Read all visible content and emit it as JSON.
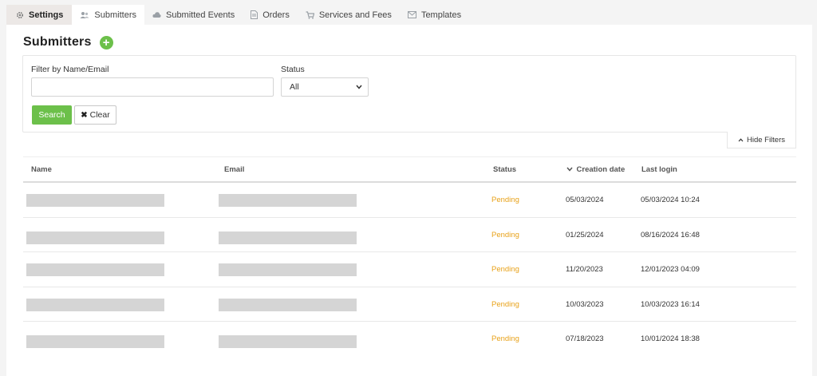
{
  "tabs": [
    {
      "label": "Settings",
      "icon": "gear-icon"
    },
    {
      "label": "Submitters",
      "icon": "users-icon"
    },
    {
      "label": "Submitted Events",
      "icon": "cloud-icon"
    },
    {
      "label": "Orders",
      "icon": "document-icon"
    },
    {
      "label": "Services and Fees",
      "icon": "cart-icon"
    },
    {
      "label": "Templates",
      "icon": "envelope-icon"
    }
  ],
  "page": {
    "title": "Submitters",
    "add_icon": "plus-circle-icon"
  },
  "filters": {
    "name_label": "Filter by Name/Email",
    "name_value": "",
    "status_label": "Status",
    "status_value": "All",
    "search_label": "Search",
    "clear_label": "Clear",
    "hide_filters_label": "Hide Filters"
  },
  "table": {
    "columns": {
      "name": "Name",
      "email": "Email",
      "status": "Status",
      "created": "Creation date",
      "last_login": "Last login"
    },
    "rows": [
      {
        "status": "Pending",
        "created": "05/03/2024",
        "last_login": "05/03/2024 10:24"
      },
      {
        "status": "Pending",
        "created": "01/25/2024",
        "last_login": "08/16/2024 16:48"
      },
      {
        "status": "Pending",
        "created": "11/20/2023",
        "last_login": "12/01/2023 04:09"
      },
      {
        "status": "Pending",
        "created": "10/03/2023",
        "last_login": "10/03/2023 16:14"
      },
      {
        "status": "Pending",
        "created": "07/18/2023",
        "last_login": "10/01/2024 18:38"
      }
    ]
  },
  "colors": {
    "accent_green": "#6cc04a",
    "pending": "#e8a21a"
  }
}
